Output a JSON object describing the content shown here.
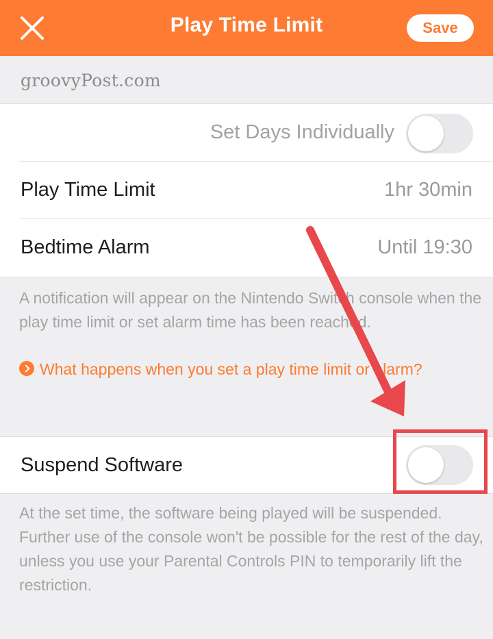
{
  "header": {
    "title": "Play Time Limit",
    "save_label": "Save",
    "close_icon": "close-icon"
  },
  "watermark": "groovyPost.com",
  "settings": {
    "set_days_label": "Set Days Individually",
    "set_days_on": false,
    "play_time_label": "Play Time Limit",
    "play_time_value": "1hr 30min",
    "bedtime_label": "Bedtime Alarm",
    "bedtime_value": "Until 19:30"
  },
  "notification_note": "A notification will appear on the Nintendo Switch console when the play time limit or set alarm time has been reached.",
  "info_link": "What happens when you set a play time limit or alarm?",
  "suspend": {
    "label": "Suspend Software",
    "on": false
  },
  "suspend_note": "At the set time, the software being played will be suspended. Further use of the console won't be possible for the rest of the day, unless you use your Parental Controls PIN to temporarily lift the restriction.",
  "colors": {
    "accent": "#fd7b33",
    "annotation": "#e8474b",
    "background": "#efeff1"
  }
}
